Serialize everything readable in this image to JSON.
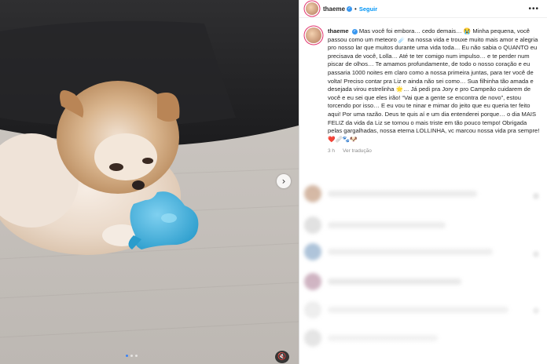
{
  "post": {
    "username": "thaeme",
    "separator": "•",
    "follow_label": "Seguir",
    "more_label": "•••"
  },
  "caption": {
    "username": "thaeme",
    "text": "Mas você foi embora… cedo demais… 😭 Minha pequena, você passou como um meteoro ☄️ na nossa vida e trouxe muito mais amor e alegria pro nosso lar que muitos durante uma vida toda… Eu não sabia o QUANTO eu precisava de você, Lolla… Até te ter comigo num impulso… e te perder num piscar de olhos… Te amamos profundamente, de todo o nosso coração e eu passaria 1000 noites em claro como a nossa primeira juntas, para ter você de volta! Preciso contar pra Liz e ainda não sei como… Sua filhinha tão amada e desejada virou estrelinha 🌟… Já pedi pra Jory e pro Campeão cuidarem de você e eu sei que eles irão! “Vai que a gente se encontra de novo”, estou torcendo por isso… E eu vou te ninar e mimar do jeito que eu queria ter feito aqui! Por uma razão. Deus te quis aí e um dia entenderei porque… o dia MAIS FELIZ da vida da Liz se tornou o mais triste em tão pouco tempo! Obrigada pelas gargalhadas, nossa eterna LOLLINHA, vc marcou nossa vida pra sempre! ❤️🩹🐾🐶"
  },
  "meta": {
    "time": "3 h",
    "translate_label": "Ver tradução"
  },
  "media": {
    "next_icon": "›",
    "mute_icon": "🔇"
  },
  "colors": {
    "accent": "#0095f6",
    "toy": "#3fb1dd",
    "verified": "#3897f0"
  }
}
